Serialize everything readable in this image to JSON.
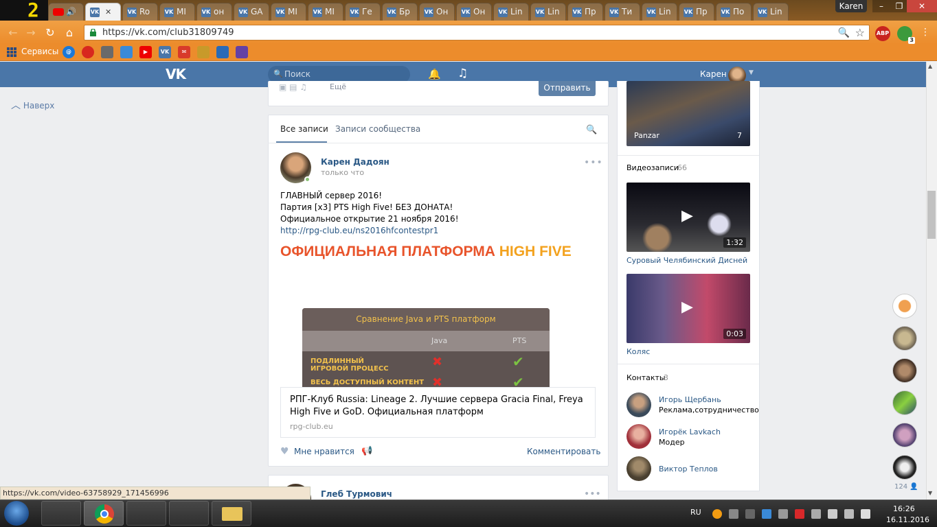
{
  "browser": {
    "tabs": [
      {
        "label": "Ro",
        "icon": "vk"
      },
      {
        "label": "MI",
        "icon": "vk"
      },
      {
        "label": "он",
        "icon": "vk"
      },
      {
        "label": "GA",
        "icon": "vk"
      },
      {
        "label": "MI",
        "icon": "vk"
      },
      {
        "label": "MI",
        "icon": "vk"
      },
      {
        "label": "Ге",
        "icon": "vk"
      },
      {
        "label": "Бр",
        "icon": "vk"
      },
      {
        "label": "Он",
        "icon": "vk"
      },
      {
        "label": "Он",
        "icon": "vk"
      },
      {
        "label": "Lin",
        "icon": "vk"
      },
      {
        "label": "Lin",
        "icon": "vk"
      },
      {
        "label": "Пр",
        "icon": "vk"
      },
      {
        "label": "Ти",
        "icon": "vk"
      },
      {
        "label": "Lin",
        "icon": "vk"
      },
      {
        "label": "Пр",
        "icon": "vk"
      },
      {
        "label": "По",
        "icon": "vk"
      },
      {
        "label": "Lin",
        "icon": "vk"
      }
    ],
    "profile_name": "Karen",
    "url": "https://vk.com/club31809749",
    "bookmarks_label": "Сервисы",
    "extensions": [
      {
        "label": "ABP",
        "badge": "2",
        "color": "#c8231e"
      },
      {
        "label": "",
        "badge": "3",
        "color": "#3c9a3c"
      }
    ],
    "status_url": "https://vk.com/video-63758929_171456996"
  },
  "vk": {
    "logo": "VK",
    "search_placeholder": "Поиск",
    "user_name": "Карен",
    "to_top": "Наверх",
    "compose": {
      "send": "Отправить",
      "more": "Ещё"
    },
    "wall_tabs": {
      "all": "Все записи",
      "community": "Записи сообщества"
    },
    "post": {
      "author": "Карен Дадоян",
      "time": "только что",
      "lines": [
        "ГЛАВНЫЙ сервер 2016!",
        "Партия [x3] PTS High Five! БЕЗ ДОНАТА!",
        "Официальное открытие 21 ноября 2016!"
      ],
      "link": "http://rpg-club.eu/ns2016hfcontestpr1",
      "banner_title_a": "ОФИЦИАЛЬНАЯ ПЛАТФОРМА",
      "banner_title_b": "HIGH FIVE",
      "table_title": "Сравнение Java и PTS платформ",
      "table_col_java": "Java",
      "table_col_pts": "PTS",
      "table_row1_a": "ПОДЛИННЫЙ",
      "table_row1_b": "ИГРОВОЙ ПРОЦЕСС",
      "table_row2": "ВЕСЬ ДОСТУПНЫЙ КОНТЕНТ",
      "link_title": "РПГ-Клуб Russia: Lineage 2. Лучшие сервера Gracia Final, Freya High Five и GoD. Официальная платформ",
      "link_domain": "rpg-club.eu",
      "like": "Мне нравится",
      "comment": "Комментировать"
    },
    "next_post": {
      "author": "Глеб Турмович"
    },
    "sidebar": {
      "album": {
        "name": "Panzar",
        "count": "7"
      },
      "videos_title": "Видеозаписи",
      "videos_count": "66",
      "videos": [
        {
          "title": "Суровый Челябинский Дисней",
          "duration": "1:32"
        },
        {
          "title": "Коляс",
          "duration": "0:03"
        }
      ],
      "contacts_title": "Контакты",
      "contacts_count": "3",
      "contacts": [
        {
          "name": "Игорь Щербань",
          "role": "Реклама,сотрудничество"
        },
        {
          "name": "Игорёк Lavkach",
          "role": "Модер"
        },
        {
          "name": "Виктор Теплов",
          "role": ""
        }
      ]
    },
    "chat_count": "124"
  },
  "taskbar": {
    "lang": "RU",
    "time": "16:26",
    "date": "16.11.2016"
  }
}
